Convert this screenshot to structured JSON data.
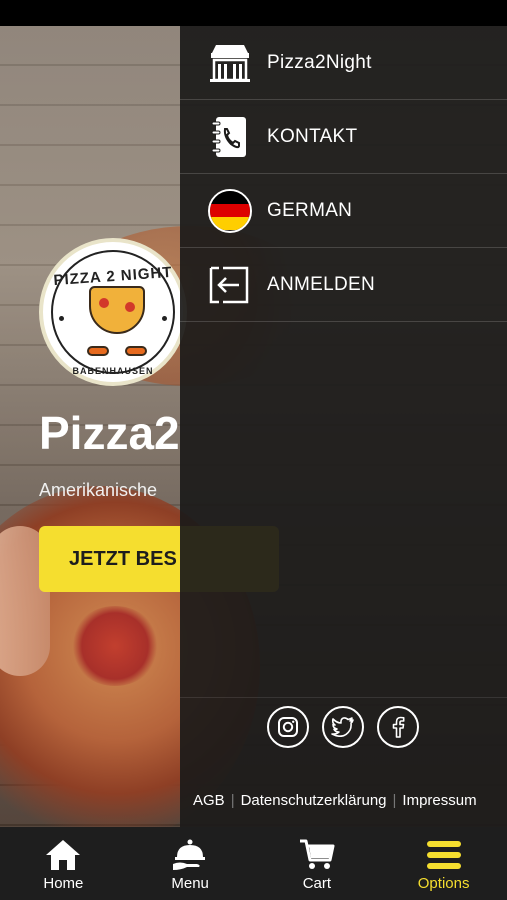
{
  "hero": {
    "logo_top_text": "PIZZA 2 NIGHT",
    "logo_bottom_text": "BABENHAUSEN",
    "title": "Pizza2",
    "subtitle": "Amerikanische",
    "order_button": "JETZT BES"
  },
  "drawer": {
    "items": [
      {
        "label": "Pizza2Night",
        "icon": "store-icon"
      },
      {
        "label": "KONTAKT",
        "icon": "contact-book-icon"
      },
      {
        "label": "GERMAN",
        "icon": "germany-flag-icon"
      },
      {
        "label": "ANMELDEN",
        "icon": "login-icon"
      }
    ],
    "social": [
      "instagram-icon",
      "twitter-icon",
      "facebook-icon"
    ],
    "footer_links": {
      "agb": "AGB",
      "privacy": "Datenschutzerklärung",
      "imprint": "Impressum"
    }
  },
  "bottom_nav": {
    "home": "Home",
    "menu": "Menu",
    "cart": "Cart",
    "options": "Options"
  },
  "colors": {
    "accent": "#f5de2f",
    "drawer_bg": "#1c1b1a",
    "nav_bg": "#1e1e1e"
  }
}
